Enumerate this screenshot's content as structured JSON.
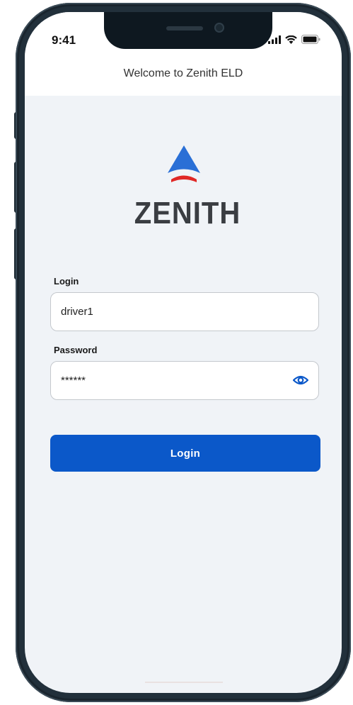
{
  "status_bar": {
    "time": "9:41",
    "icons": [
      "signal-icon",
      "wifi-icon",
      "battery-icon"
    ]
  },
  "header": {
    "title": "Welcome to Zenith ELD"
  },
  "brand": {
    "wordmark": "ZENITH",
    "logo_icon": "zenith-logo-icon",
    "colors": {
      "triangle": "#2a6fd6",
      "arc": "#e02826",
      "wordmark": "#3a3d42"
    }
  },
  "form": {
    "login_label": "Login",
    "login_value": "driver1",
    "password_label": "Password",
    "password_value": "******",
    "password_toggle_icon": "eye-icon",
    "submit_label": "Login"
  },
  "colors": {
    "accent": "#0b58c9",
    "background": "#f0f3f7",
    "header_bg": "#ffffff"
  }
}
